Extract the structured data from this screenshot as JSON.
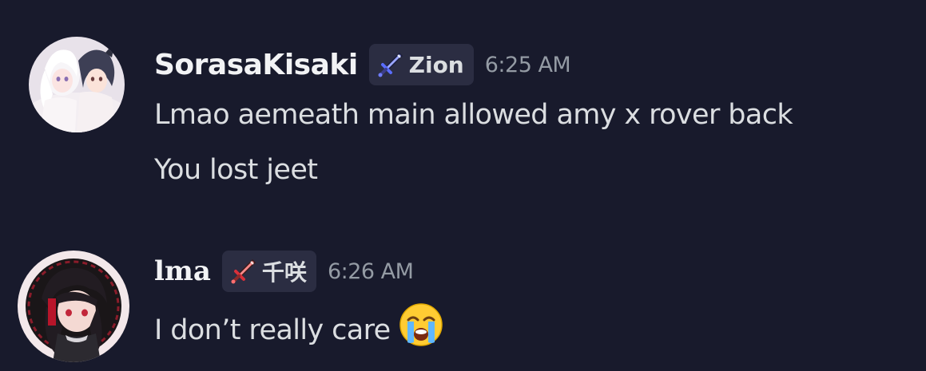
{
  "messages": [
    {
      "username": "SorasaKisaki",
      "role_tag": "Zion",
      "role_icon": "sword-icon-blue",
      "timestamp": "6:25 AM",
      "lines": [
        "Lmao aemeath main allowed amy x rover back",
        "You lost jeet"
      ]
    },
    {
      "username": "lma",
      "role_tag": "千咲",
      "role_icon": "sword-icon-red",
      "timestamp": "6:26 AM",
      "lines": [
        "I don’t really care"
      ],
      "emoji": "loudly-crying-face"
    }
  ],
  "colors": {
    "background": "#181a2c",
    "tag_background": "#2b2d42",
    "username": "#f2f3f5",
    "text": "#dbdee1",
    "timestamp": "#949ba4"
  }
}
